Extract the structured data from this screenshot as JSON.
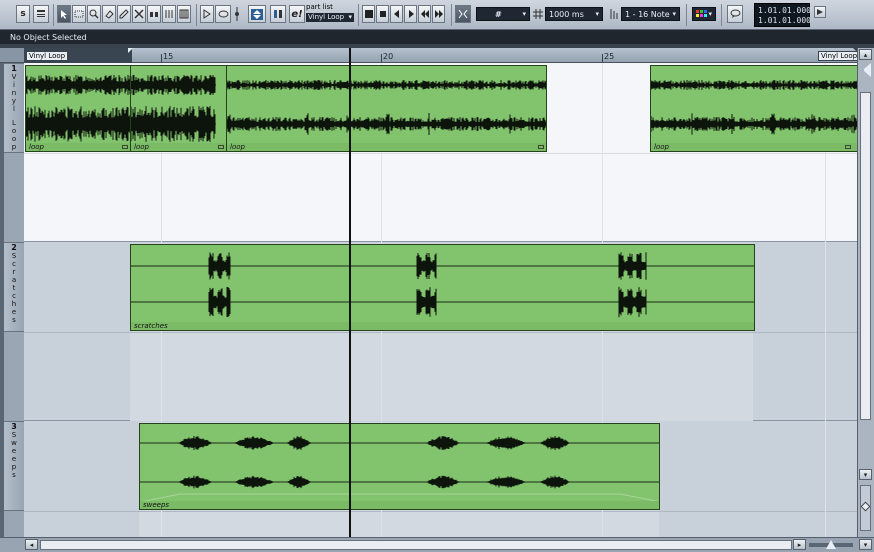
{
  "toolbar": {
    "part_list_label": "part list",
    "part_list_value": "Vinyl Loop",
    "grid_label": "#",
    "quantize_value": "1000 ms",
    "note_value": "1 - 16 Note",
    "position_top": "1.01.01.000",
    "position_bottom": "1.01.01.000"
  },
  "infoline": {
    "text": "No Object Selected"
  },
  "ruler": {
    "left_locator": "Vinyl Loop",
    "right_locator": "Vinyl Loop",
    "markers": [
      "15",
      "20",
      "25"
    ]
  },
  "tracks": [
    {
      "number": "1",
      "letters": [
        "V",
        "i",
        "n",
        "y",
        "l",
        "",
        "L",
        "o",
        "o",
        "p"
      ]
    },
    {
      "number": "2",
      "letters": [
        "S",
        "c",
        "r",
        "a",
        "t",
        "c",
        "h",
        "e",
        "s"
      ]
    },
    {
      "number": "3",
      "letters": [
        "S",
        "w",
        "e",
        "e",
        "p",
        "s"
      ]
    }
  ],
  "events": {
    "loop1": "loop",
    "loop2": "loop",
    "loop3": "loop",
    "loop4": "loop",
    "scratches": "scratches",
    "sweeps": "sweeps"
  },
  "colors": {
    "event_fill": "#82c46d",
    "selected_lane": "#f4f6f9",
    "lane": "#c8d0d9",
    "cursor": "#121212"
  }
}
